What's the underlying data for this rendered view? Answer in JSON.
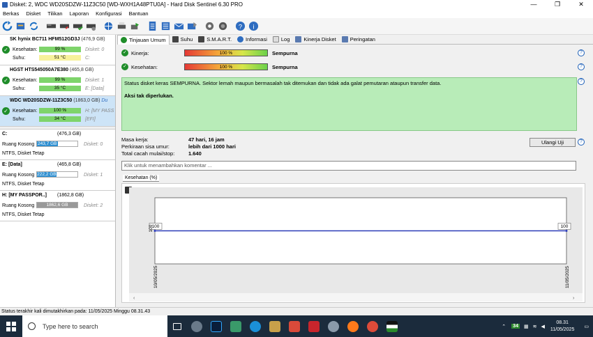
{
  "window": {
    "title": "Disket: 2, WDC WD20SDZW-11Z3C50 [WD-WXH1A48PTU0A]  -  Hard Disk Sentinel 6.30 PRO",
    "min": "—",
    "max": "❐",
    "close": "✕"
  },
  "menu": [
    "Berkas",
    "Disket",
    "Tilikan",
    "Laporan",
    "Konfigurasi",
    "Bantuan"
  ],
  "disks": [
    {
      "name": "SK hynix BC711 HFM512GD3J",
      "size": "(476,9 GB)",
      "health_label": "Kesehatan:",
      "health": "99 %",
      "temp_label": "Suhu:",
      "temp": "51 °C",
      "disk_label": "Disket: 0",
      "drive": "C:"
    },
    {
      "name": "HGST HTS545050A7E380",
      "size": "(465,8 GB)",
      "health_label": "Kesehatan:",
      "health": "99 %",
      "temp_label": "Suhu:",
      "temp": "35 °C",
      "disk_label": "Disket: 1",
      "drive": "E: [Data]"
    },
    {
      "name": "WDC WD20SDZW-11Z3C50",
      "size": "(1863,0 GB)",
      "suffix": "Du",
      "health_label": "Kesehatan:",
      "health": "100 %",
      "temp_label": "Suhu:",
      "temp": "34 °C",
      "disk_label": "H: [MY PASS",
      "drive": "[EFI]"
    }
  ],
  "partitions": [
    {
      "name": "C:",
      "size": "(476,3 GB)",
      "free_label": "Ruang Kosong",
      "free": "243,7 GB",
      "fill": 0.51,
      "disk": "Disket: 0",
      "fs": "NTFS, Disket Tetap"
    },
    {
      "name": "E: [Data]",
      "size": "(465,8 GB)",
      "free_label": "Ruang Kosong",
      "free": "222,2 GB",
      "fill": 0.48,
      "disk": "Disket: 1",
      "fs": "NTFS, Disket Tetap"
    },
    {
      "name": "H: [MY PASSPOR..]",
      "size": "(1862,8 GB)",
      "free_label": "Ruang Kosong",
      "free": "1862,6 GB",
      "fill": 1.0,
      "disk": "Disket: 2",
      "fs": "NTFS, Disket Tetap"
    }
  ],
  "tabs": [
    "Tinjauan Umum",
    "Suhu",
    "S.M.A.R.T.",
    "Informasi",
    "Log",
    "Kinerja Disket",
    "Peringatan"
  ],
  "performance": {
    "label": "Kinerja:",
    "value": "100 %",
    "word": "Sempurna"
  },
  "health": {
    "label": "Kesehatan:",
    "value": "100 %",
    "word": "Sempurna"
  },
  "status": {
    "text": "Status disket keras SEMPURNA. Sektor lemah maupun bermasalah tak ditemukan dan tidak ada galat pemutaran ataupun transfer data.",
    "action": "Aksi tak diperlukan."
  },
  "info": [
    {
      "k": "Masa kerja:",
      "v": "47 hari, 16 jam"
    },
    {
      "k": "Perkiraan sisa umur:",
      "v": "lebih dari 1000 hari"
    },
    {
      "k": "Total cacah mulai/stop:",
      "v": "1.640"
    }
  ],
  "retest": "Ulangi Uji",
  "comment_placeholder": "Klik untuk menambahkan komentar ...",
  "chart_tab": "Kesehatan (%)",
  "chart_data": {
    "type": "line",
    "x": [
      "10/05/2025",
      "11/05/2025"
    ],
    "series": [
      {
        "values": [
          100,
          100
        ]
      }
    ],
    "y_axis_label": "100",
    "labels": [
      "100",
      "100"
    ],
    "color": "#2b3bb8"
  },
  "statusline": "Status terakhir kali dimutakhirkan pada: 11/05/2025 Minggu 08.31.43",
  "taskbar": {
    "search": "Type here to search",
    "time": "08.31",
    "date": "11/05/2025",
    "badge": "34"
  }
}
